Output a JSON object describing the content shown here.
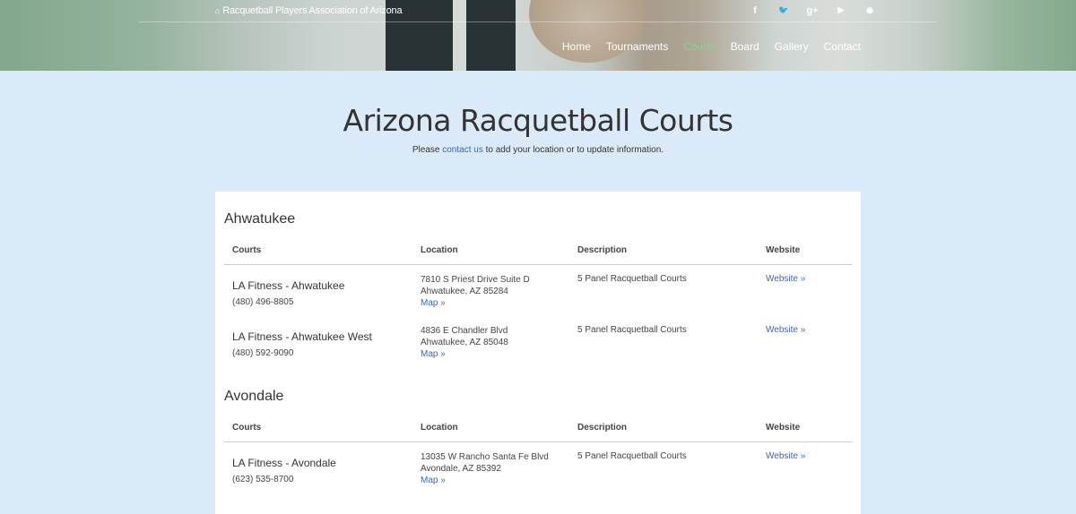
{
  "header": {
    "brand": "Racquetball Players Association of Arizona",
    "social_icons": [
      {
        "name": "facebook-icon",
        "glyph": "f"
      },
      {
        "name": "twitter-icon",
        "glyph": "🐦"
      },
      {
        "name": "google-plus-icon",
        "glyph": "g+"
      },
      {
        "name": "youtube-icon",
        "glyph": "▶"
      },
      {
        "name": "rss-icon",
        "glyph": "◉"
      }
    ],
    "nav": [
      {
        "label": "Home",
        "active": false
      },
      {
        "label": "Tournaments",
        "active": false
      },
      {
        "label": "Courts",
        "active": true
      },
      {
        "label": "Board",
        "active": false
      },
      {
        "label": "Gallery",
        "active": false
      },
      {
        "label": "Contact",
        "active": false
      }
    ],
    "accent_color": "#7bd98a"
  },
  "page": {
    "title": "Arizona Racquetball Courts",
    "subtitle_before": "Please ",
    "subtitle_link": "contact us",
    "subtitle_after": " to add your location or to update information."
  },
  "columns": [
    "Courts",
    "Location",
    "Description",
    "Website"
  ],
  "regions": [
    {
      "name": "Ahwatukee",
      "courts": [
        {
          "name": "LA Fitness - Ahwatukee",
          "phone": "(480) 496-8805",
          "address1": "7810 S Priest Drive Suite D",
          "address2": "Ahwatukee, AZ 85284",
          "map": "Map »",
          "description": "5 Panel Racquetball Courts",
          "website": "Website »"
        },
        {
          "name": "LA Fitness - Ahwatukee West",
          "phone": "(480) 592-9090",
          "address1": "4836 E Chandler Blvd",
          "address2": "Ahwatukee, AZ 85048",
          "map": "Map »",
          "description": "5 Panel Racquetball Courts",
          "website": "Website »"
        }
      ]
    },
    {
      "name": "Avondale",
      "courts": [
        {
          "name": "LA Fitness - Avondale",
          "phone": "(623) 535-8700",
          "address1": "13035 W Rancho Santa Fe Blvd",
          "address2": "Avondale, AZ 85392",
          "map": "Map »",
          "description": "5 Panel Racquetball Courts",
          "website": "Website »"
        }
      ]
    }
  ]
}
